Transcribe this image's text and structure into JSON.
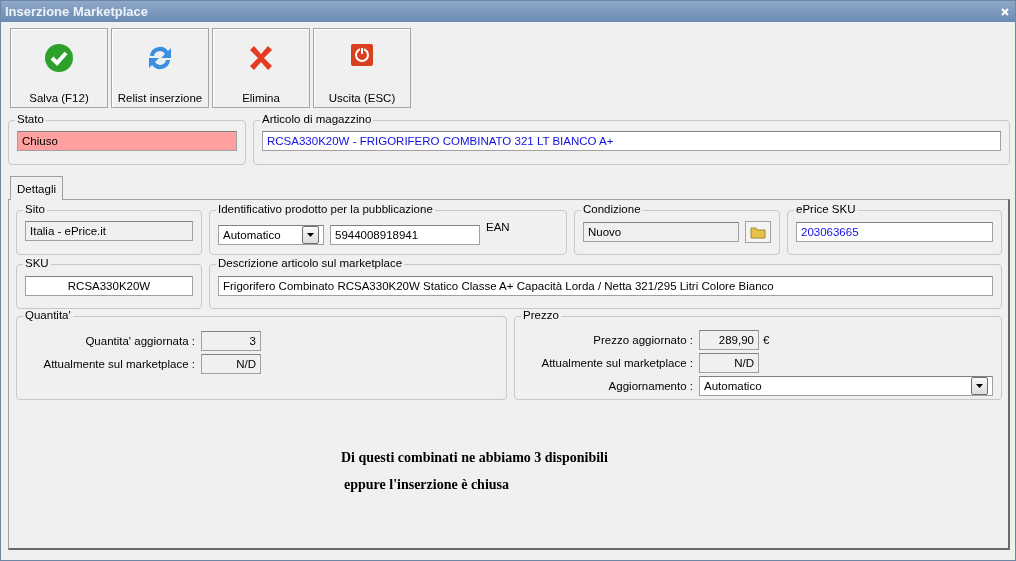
{
  "window": {
    "title": "Inserzione Marketplace"
  },
  "toolbar": [
    {
      "label": "Salva (F12)",
      "kind": "save"
    },
    {
      "label": "Relist inserzione",
      "kind": "relist"
    },
    {
      "label": "Elimina",
      "kind": "delete"
    },
    {
      "label": "Uscita (ESC)",
      "kind": "exit"
    }
  ],
  "stato": {
    "label": "Stato",
    "value": "Chiuso"
  },
  "articolo": {
    "label": "Articolo di magazzino",
    "value": "RCSA330K20W - FRIGORIFERO COMBINATO 321 LT BIANCO A+"
  },
  "tabs": [
    {
      "label": "Dettagli",
      "selected": true
    }
  ],
  "sito": {
    "label": "Sito",
    "value": "Italia - ePrice.it"
  },
  "identificativo": {
    "label": "Identificativo prodotto per la pubblicazione",
    "type": "Automatico",
    "value": "5944008918941",
    "suffix": "EAN"
  },
  "condizione": {
    "label": "Condizione",
    "value": "Nuovo"
  },
  "eprice_sku": {
    "label": "ePrice SKU",
    "value": "203063665"
  },
  "sku": {
    "label": "SKU",
    "value": "RCSA330K20W"
  },
  "descrizione": {
    "label": "Descrizione articolo sul marketplace",
    "value": "Frigorifero Combinato RCSA330K20W Statico Classe A+ Capacità Lorda / Netta 321/295 Litri Colore Bianco"
  },
  "quantita": {
    "label": "Quantita'",
    "rows": [
      {
        "label": "Quantita' aggiornata :",
        "value": "3",
        "kind": "readonly"
      },
      {
        "label": "Attualmente sul marketplace :",
        "value": "N/D",
        "kind": "readonly"
      }
    ]
  },
  "prezzo": {
    "label": "Prezzo",
    "rows": [
      {
        "label": "Prezzo aggiornato :",
        "value": "289,90",
        "suffix": "€",
        "kind": "readonly"
      },
      {
        "label": "Attualmente sul marketplace :",
        "value": "N/D",
        "kind": "readonly"
      },
      {
        "label": "Aggiornamento :",
        "value": "Automatico",
        "kind": "select"
      }
    ]
  },
  "note": [
    "Di questi combinati ne abbiamo 3 disponibili",
    "eppure l'inserzione è chiusa"
  ]
}
